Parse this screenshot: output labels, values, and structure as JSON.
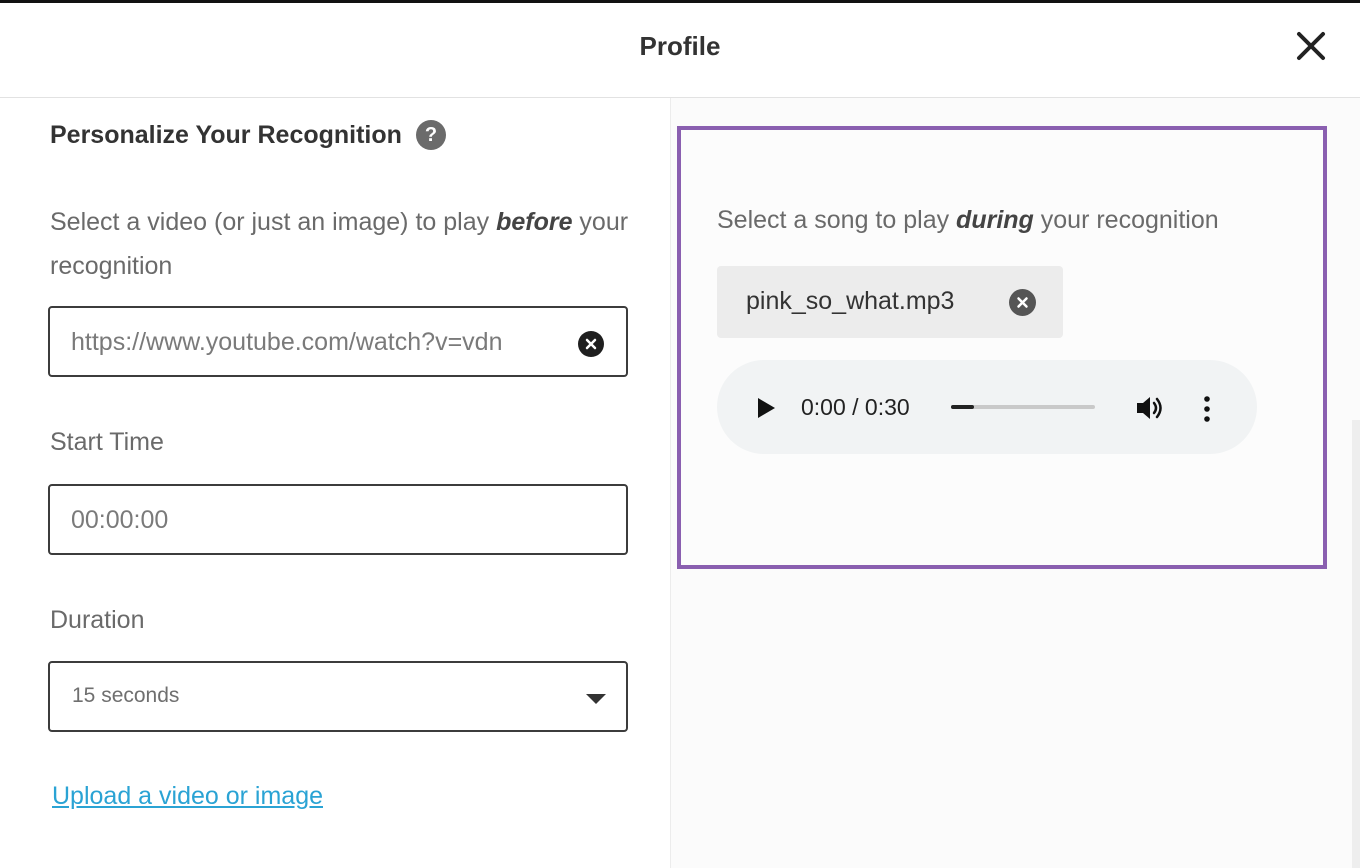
{
  "header": {
    "title": "Profile",
    "close_icon": "close-icon"
  },
  "personalize": {
    "title": "Personalize Your Recognition",
    "help_icon": "?",
    "desc_pre": "Select a video (or just an image) to play ",
    "desc_em": "before",
    "desc_post": " your recognition",
    "video_url": "https://www.youtube.com/watch?v=vdn",
    "start_time_label": "Start Time",
    "start_time_value": "00:00:00",
    "duration_label": "Duration",
    "duration_value": "15 seconds",
    "upload_link": "Upload a video or image"
  },
  "song": {
    "desc_pre": "Select a song to play ",
    "desc_em": "during",
    "desc_post": " your recognition",
    "file_name": "pink_so_what.mp3",
    "player": {
      "time": "0:00 / 0:30",
      "progress": 0.16
    }
  },
  "colors": {
    "highlight": "#8a5fb0",
    "link": "#2aa3d4"
  }
}
